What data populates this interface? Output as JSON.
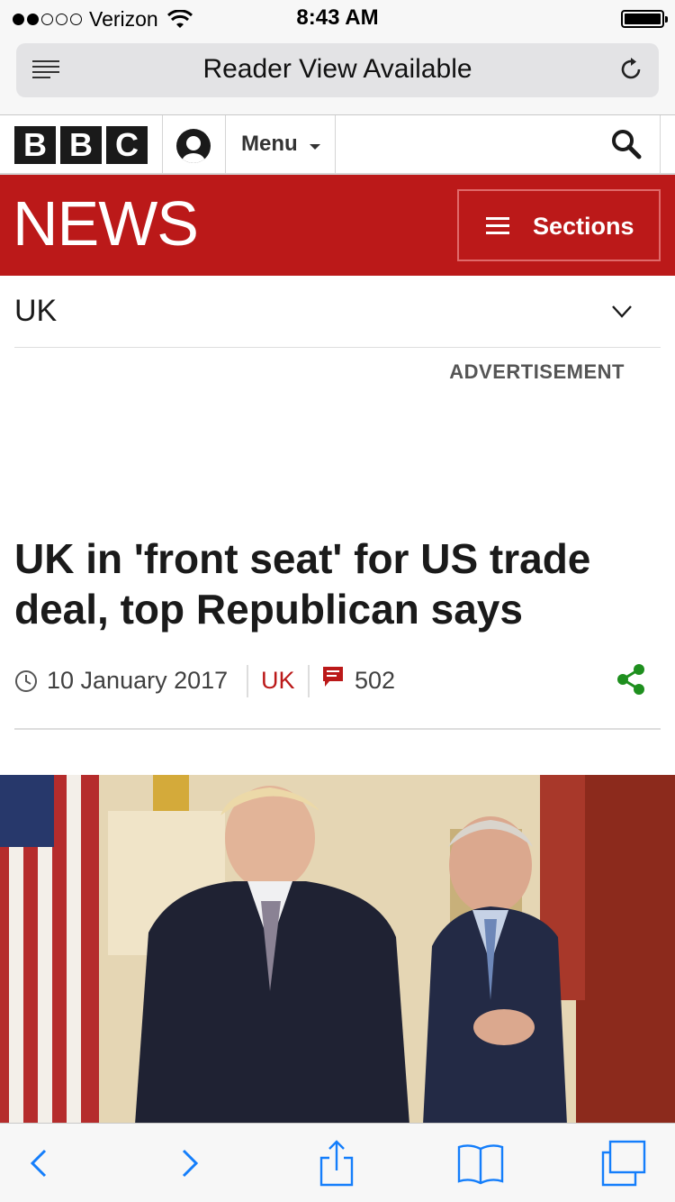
{
  "status_bar": {
    "carrier": "Verizon",
    "time": "8:43 AM",
    "signal_bars_filled": 2,
    "signal_bars_total": 5
  },
  "browser": {
    "address_text": "Reader View Available",
    "icons": [
      "reader-view-icon",
      "reload-icon"
    ]
  },
  "site_header": {
    "logo_letters": [
      "B",
      "B",
      "C"
    ],
    "menu_label": "Menu",
    "icons": [
      "account-icon",
      "search-icon"
    ]
  },
  "news_banner": {
    "title": "NEWS",
    "sections_label": "Sections",
    "color": "#bb1919"
  },
  "section_nav": {
    "current": "UK"
  },
  "advertisement_label": "ADVERTISEMENT",
  "article": {
    "headline": "UK in 'front seat' for US trade deal, top Republican says",
    "date": "10 January 2017",
    "section": "UK",
    "comments": "502",
    "accent_color": "#bb1919",
    "share_color": "#1e8f1e"
  },
  "toolbar": {
    "icons": [
      "back-icon",
      "forward-icon",
      "share-icon",
      "bookmarks-icon",
      "tabs-icon"
    ],
    "tint": "#147efb"
  }
}
